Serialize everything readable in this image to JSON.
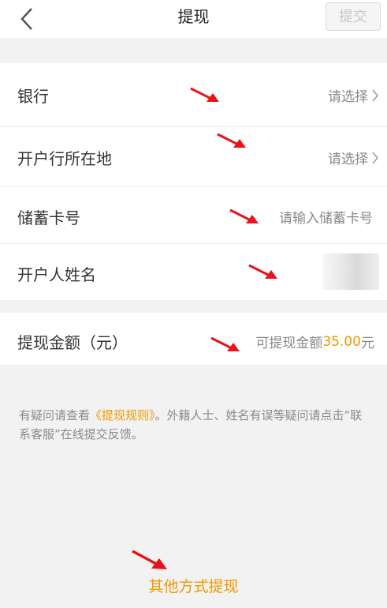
{
  "header": {
    "title": "提现",
    "submit_label": "提交"
  },
  "form": {
    "bank_label": "银行",
    "bank_value": "请选择",
    "branch_location_label": "开户行所在地",
    "branch_location_value": "请选择",
    "card_number_label": "储蓄卡号",
    "card_number_placeholder": "请输入储蓄卡号",
    "holder_name_label": "开户人姓名"
  },
  "amount": {
    "label": "提现金额（元）",
    "available_prefix": "可提现金额",
    "available_value": "35.00",
    "available_unit": "元"
  },
  "note": {
    "part1": "有疑问请查看",
    "rules_link": "《提现规则》",
    "part2": "。外籍人士、姓名有误等疑问请点击“联系客服”在线提交反馈。"
  },
  "other_methods_label": "其他方式提现",
  "colors": {
    "accent": "#f39800",
    "annotation_arrow": "#e8121b"
  },
  "icons": {
    "back": "chevron-left-icon",
    "chevron": "chevron-right-icon",
    "arrow": "red-arrow-icon"
  }
}
